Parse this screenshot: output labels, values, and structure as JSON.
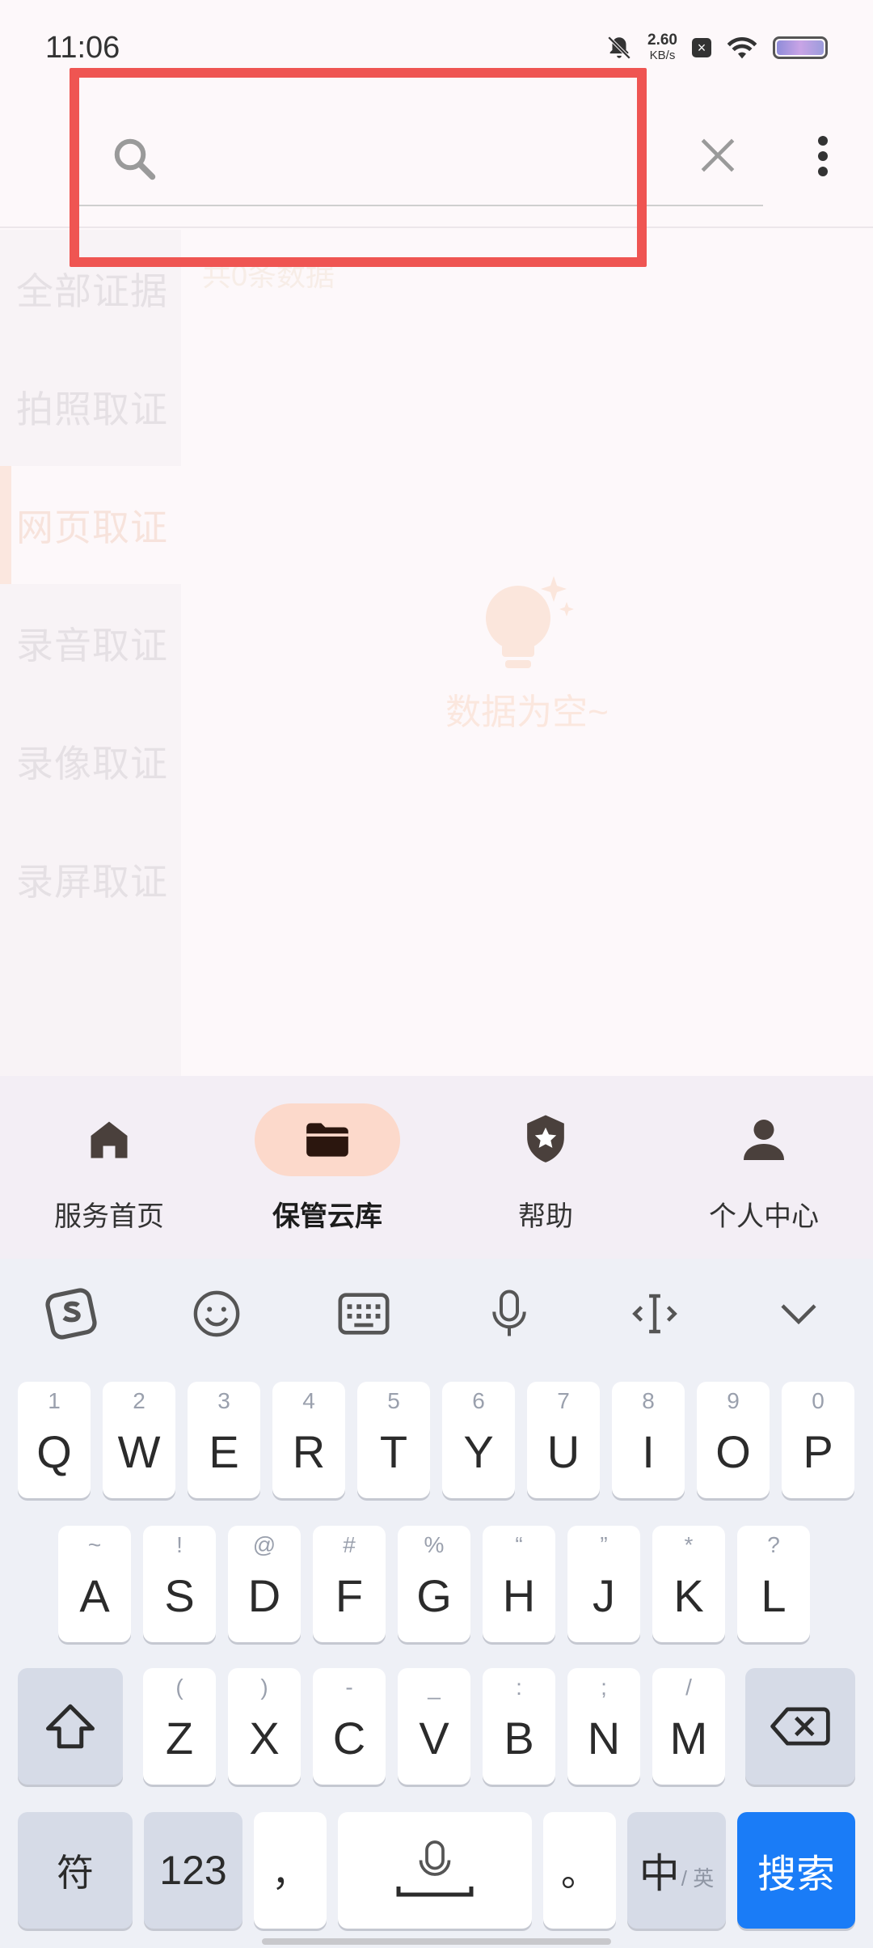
{
  "status_bar": {
    "time": "11:06",
    "net_speed_value": "2.60",
    "net_speed_unit": "KB/s",
    "icons": [
      "mute-bell-icon",
      "x-notification-icon",
      "wifi-icon",
      "battery-icon"
    ]
  },
  "search": {
    "value": "",
    "placeholder": ""
  },
  "sidenav": {
    "items": [
      {
        "label": "全部证据"
      },
      {
        "label": "拍照取证"
      },
      {
        "label": "网页取证"
      },
      {
        "label": "录音取证"
      },
      {
        "label": "录像取证"
      },
      {
        "label": "录屏取证"
      }
    ],
    "active_index": 2
  },
  "main": {
    "count_text": "共0条数据",
    "empty_text": "数据为空~"
  },
  "bottom_nav": {
    "tabs": [
      {
        "label": "服务首页",
        "icon": "home-icon"
      },
      {
        "label": "保管云库",
        "icon": "folder-icon"
      },
      {
        "label": "帮助",
        "icon": "shield-star-icon"
      },
      {
        "label": "个人中心",
        "icon": "person-icon"
      }
    ],
    "active_index": 1
  },
  "keyboard": {
    "toolbar_icons": [
      "sogou-logo-icon",
      "emoji-icon",
      "keyboard-icon",
      "microphone-icon",
      "cursor-icon",
      "collapse-chevron-icon"
    ],
    "row1": [
      {
        "hint": "1",
        "char": "Q"
      },
      {
        "hint": "2",
        "char": "W"
      },
      {
        "hint": "3",
        "char": "E"
      },
      {
        "hint": "4",
        "char": "R"
      },
      {
        "hint": "5",
        "char": "T"
      },
      {
        "hint": "6",
        "char": "Y"
      },
      {
        "hint": "7",
        "char": "U"
      },
      {
        "hint": "8",
        "char": "I"
      },
      {
        "hint": "9",
        "char": "O"
      },
      {
        "hint": "0",
        "char": "P"
      }
    ],
    "row2": [
      {
        "hint": "~",
        "char": "A"
      },
      {
        "hint": "!",
        "char": "S"
      },
      {
        "hint": "@",
        "char": "D"
      },
      {
        "hint": "#",
        "char": "F"
      },
      {
        "hint": "%",
        "char": "G"
      },
      {
        "hint": "“",
        "char": "H"
      },
      {
        "hint": "”",
        "char": "J"
      },
      {
        "hint": "*",
        "char": "K"
      },
      {
        "hint": "?",
        "char": "L"
      }
    ],
    "row3": [
      {
        "hint": "(",
        "char": "Z"
      },
      {
        "hint": ")",
        "char": "X"
      },
      {
        "hint": "-",
        "char": "C"
      },
      {
        "hint": "_",
        "char": "V"
      },
      {
        "hint": ":",
        "char": "B"
      },
      {
        "hint": ";",
        "char": "N"
      },
      {
        "hint": "/",
        "char": "M"
      }
    ],
    "symbols_label": "符",
    "numbers_label": "123",
    "comma_label": "，",
    "period_label": "。",
    "lang_main": "中",
    "lang_sub": "/ 英",
    "search_label": "搜索"
  },
  "colors": {
    "accent_red_highlight": "#ef5552",
    "active_tab_pill": "#fcd9cb",
    "search_key": "#1a7cf7"
  }
}
